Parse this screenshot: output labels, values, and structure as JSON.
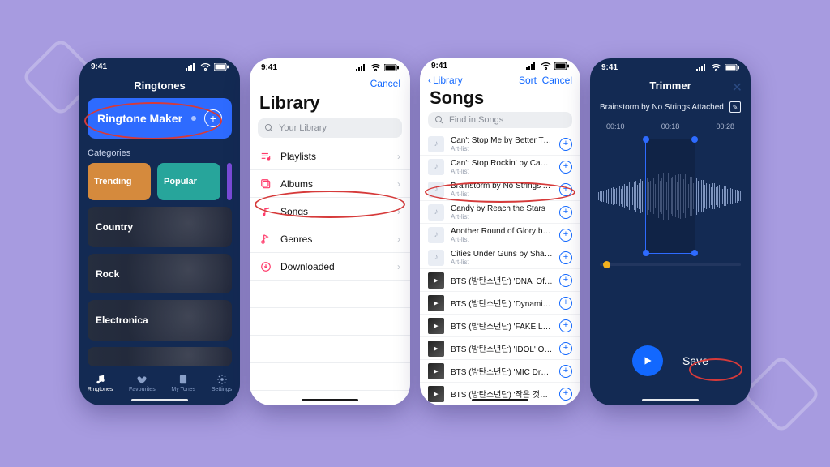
{
  "status_time": "9:41",
  "phone1": {
    "header": "Ringtones",
    "card_title": "Ringtone Maker",
    "categories_label": "Categories",
    "chips": [
      "Trending",
      "Popular"
    ],
    "rows": [
      "Country",
      "Rock",
      "Electronica"
    ],
    "tabs": [
      "Ringtones",
      "Favourites",
      "My Tones",
      "Settings"
    ]
  },
  "phone2": {
    "cancel": "Cancel",
    "title": "Library",
    "search_placeholder": "Your Library",
    "items": [
      {
        "icon": "playlist",
        "label": "Playlists"
      },
      {
        "icon": "album",
        "label": "Albums"
      },
      {
        "icon": "song",
        "label": "Songs"
      },
      {
        "icon": "genre",
        "label": "Genres"
      },
      {
        "icon": "download",
        "label": "Downloaded"
      }
    ]
  },
  "phone3": {
    "back": "Library",
    "sort": "Sort",
    "cancel": "Cancel",
    "title": "Songs",
    "search_placeholder": "Find in Songs",
    "songs": [
      {
        "title": "Can't Stop Me by Better Times",
        "sub": "Art-list",
        "art": true
      },
      {
        "title": "Can't Stop Rockin' by Can't Get E…",
        "sub": "Art-list",
        "art": true
      },
      {
        "title": "Brainstorm by No Strings Attached",
        "sub": "Art-list",
        "art": true
      },
      {
        "title": "Candy by Reach the Stars",
        "sub": "Art-list",
        "art": true
      },
      {
        "title": "Another Round of Glory by The R…",
        "sub": "Art-list",
        "art": true
      },
      {
        "title": "Cities Under Guns by Sharp Thin…",
        "sub": "Art-list",
        "art": true
      },
      {
        "title": "BTS (방탄소년단) 'DNA' Official MV",
        "sub": "",
        "art": false
      },
      {
        "title": "BTS (방탄소년단) 'Dynamite' Offici…",
        "sub": "",
        "art": false
      },
      {
        "title": "BTS (방탄소년단) 'FAKE LOVE' Offi…",
        "sub": "",
        "art": false
      },
      {
        "title": "BTS (방탄소년단) 'IDOL' Official MV",
        "sub": "",
        "art": false
      },
      {
        "title": "BTS (방탄소년단) 'MIC Drop (Steve…",
        "sub": "",
        "art": false
      },
      {
        "title": "BTS (방탄소년단) '작은 것들을 위한…",
        "sub": "",
        "art": false
      }
    ]
  },
  "phone4": {
    "header": "Trimmer",
    "track": "Brainstorm by No Strings Attached",
    "times": [
      "00:10",
      "00:18",
      "00:28"
    ],
    "save": "Save"
  }
}
